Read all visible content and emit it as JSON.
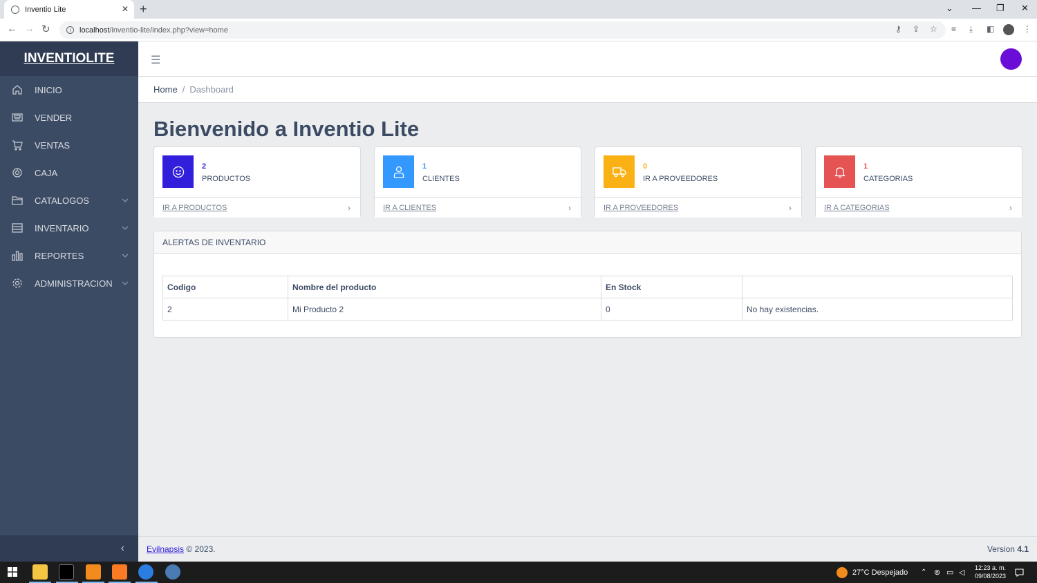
{
  "browser": {
    "tab_title": "Inventio Lite",
    "url_host": "localhost",
    "url_path": "/inventio-lite/index.php?view=home"
  },
  "sidebar": {
    "brand": "INVENTIOLITE",
    "items": [
      {
        "label": "INICIO",
        "icon": "home-icon"
      },
      {
        "label": "VENDER",
        "icon": "cash-register-icon"
      },
      {
        "label": "VENTAS",
        "icon": "cart-icon"
      },
      {
        "label": "CAJA",
        "icon": "safe-icon"
      },
      {
        "label": "CATALOGOS",
        "icon": "folder-icon"
      },
      {
        "label": "INVENTARIO",
        "icon": "list-icon"
      },
      {
        "label": "REPORTES",
        "icon": "bar-chart-icon"
      },
      {
        "label": "ADMINISTRACION",
        "icon": "gear-icon"
      }
    ]
  },
  "breadcrumb": {
    "home": "Home",
    "current": "Dashboard"
  },
  "main": {
    "title": "Bienvenido a Inventio Lite",
    "cards": [
      {
        "value": "2",
        "label": "PRODUCTOS",
        "link": "IR A PRODUCTOS",
        "color": "#321fdb",
        "icon": "smile-icon"
      },
      {
        "value": "1",
        "label": "CLIENTES",
        "link": "IR A CLIENTES",
        "color": "#3399ff",
        "icon": "user-icon"
      },
      {
        "value": "0",
        "label": "IR A PROVEEDORES",
        "link": "IR A PROVEEDORES",
        "color": "#f9b115",
        "icon": "truck-icon"
      },
      {
        "value": "1",
        "label": "CATEGORIAS",
        "link": "IR A CATEGORIAS",
        "color": "#e55353",
        "icon": "bell-icon"
      }
    ],
    "alerts": {
      "title": "ALERTAS DE INVENTARIO",
      "columns": [
        "Codigo",
        "Nombre del producto",
        "En Stock",
        ""
      ],
      "rows": [
        [
          "2",
          "Mi Producto 2",
          "0",
          "No hay existencias."
        ]
      ]
    }
  },
  "footer": {
    "author": "Evilnapsis ",
    "copyright": "© 2023.",
    "version_label": "Version ",
    "version_number": "4.1"
  },
  "taskbar": {
    "weather": "27°C  Despejado",
    "time": "12:23 a. m.",
    "date": "09/08/2023"
  }
}
